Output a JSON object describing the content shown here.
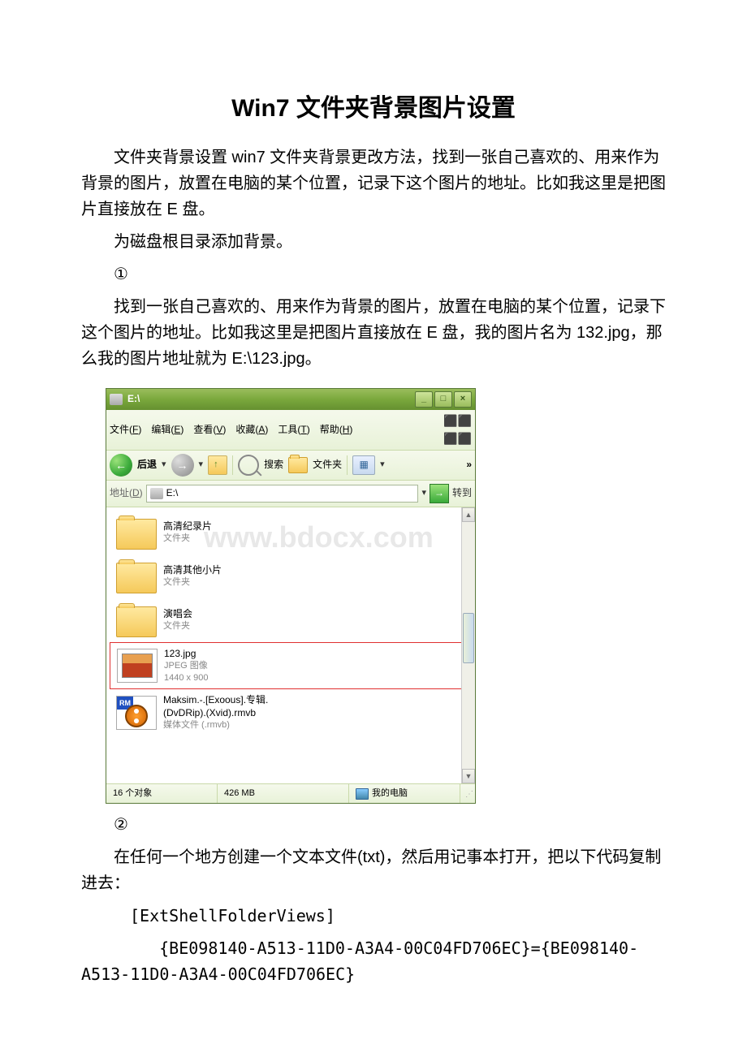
{
  "doc": {
    "title": "Win7 文件夹背景图片设置",
    "para_intro": "文件夹背景设置 win7 文件夹背景更改方法，找到一张自己喜欢的、用来作为背景的图片，放置在电脑的某个位置，记录下这个图片的地址。比如我这里是把图片直接放在 E 盘。",
    "step_root": "为磁盘根目录添加背景。",
    "step1_num": "①",
    "step1_text": "找到一张自己喜欢的、用来作为背景的图片，放置在电脑的某个位置，记录下这个图片的地址。比如我这里是把图片直接放在 E 盘，我的图片名为 132.jpg，那么我的图片地址就为 E:\\123.jpg。",
    "step2_num": "②",
    "step2_text": "在任何一个地方创建一个文本文件(txt)，然后用记事本打开，把以下代码复制进去：",
    "code1": "[ExtShellFolderViews]",
    "code2": "{BE098140-A513-11D0-A3A4-00C04FD706EC}={BE098140-A513-11D0-A3A4-00C04FD706EC}"
  },
  "explorer": {
    "title": "E:\\",
    "menus": {
      "file": "文件(F)",
      "edit": "编辑(E)",
      "view": "查看(V)",
      "fav": "收藏(A)",
      "tools": "工具(T)",
      "help": "帮助(H)"
    },
    "toolbar": {
      "back": "后退",
      "search": "搜索",
      "folders": "文件夹"
    },
    "address": {
      "label": "地址(D)",
      "path": "E:\\",
      "go": "转到"
    },
    "watermark": "www.bdocx.com",
    "items": {
      "folder1": {
        "name": "高清纪录片",
        "meta": "文件夹"
      },
      "folder2": {
        "name": "高清其他小片",
        "meta": "文件夹"
      },
      "folder3": {
        "name": "演唱会",
        "meta": "文件夹"
      },
      "image": {
        "name": "123.jpg",
        "meta1": "JPEG 图像",
        "meta2": "1440 x 900"
      },
      "video": {
        "name": "Maksim.-.[Exoous].专辑.",
        "meta1": "(DvDRip).(Xvid).rmvb",
        "meta2": "媒体文件 (.rmvb)",
        "rm": "RM"
      }
    },
    "status": {
      "objects": "16 个对象",
      "size": "426 MB",
      "location": "我的电脑"
    }
  }
}
